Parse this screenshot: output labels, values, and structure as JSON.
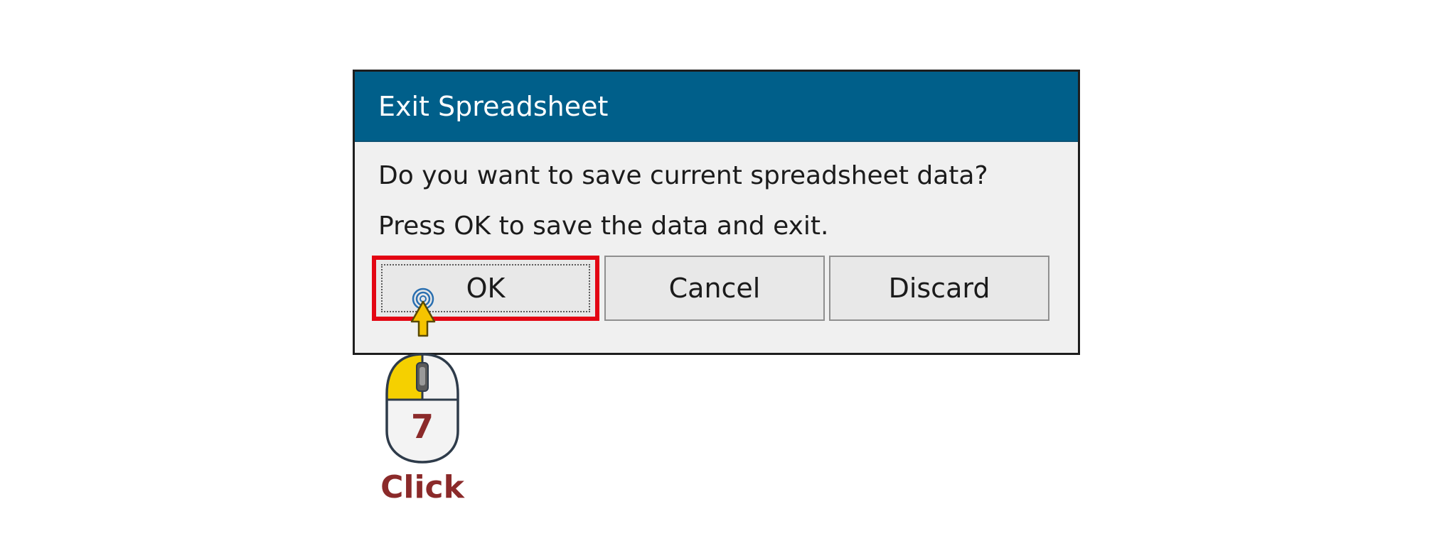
{
  "dialog": {
    "title": "Exit Spreadsheet",
    "message_line1": "Do you want to save current spreadsheet data?",
    "message_line2": "Press OK to save the data and exit.",
    "buttons": {
      "ok": "OK",
      "cancel": "Cancel",
      "discard": "Discard"
    }
  },
  "annotation": {
    "step_number": "7",
    "action_label": "Click",
    "highlight_color": "#e30613",
    "label_color": "#8b2a2a",
    "mouse_button_color": "#f5d000",
    "icons": [
      "cursor-arrow-icon",
      "click-ripple-icon",
      "mouse-icon"
    ]
  },
  "colors": {
    "titlebar": "#005f8a",
    "dialog_background": "#f0f0f0"
  }
}
